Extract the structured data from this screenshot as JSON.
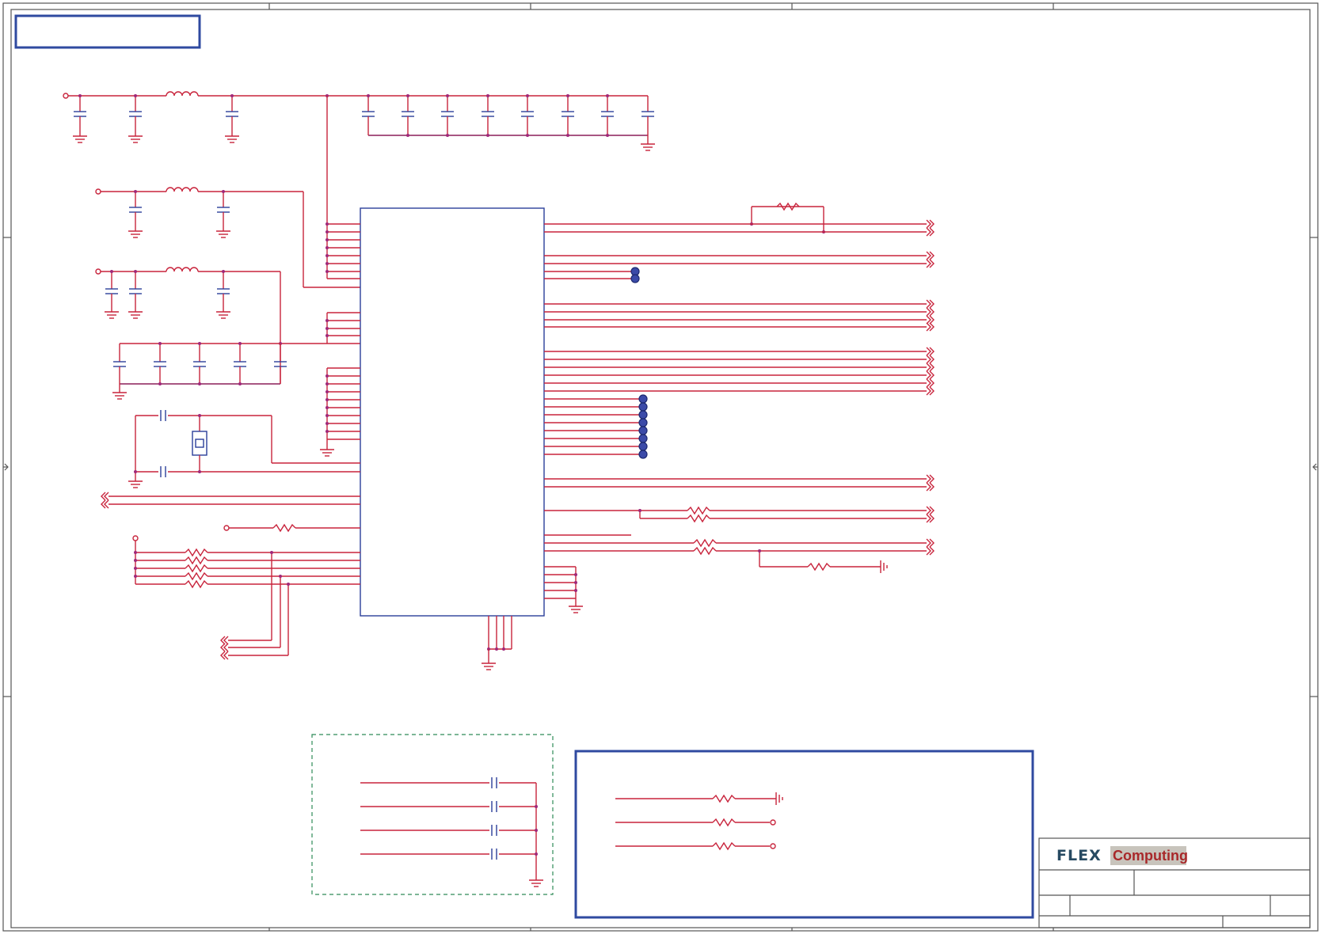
{
  "sheet": {
    "background": "#ffffff",
    "wire_color": "#c8243c",
    "junction_color": "#a0287a",
    "symbol_color": "#2b3f9a",
    "note_box_color": "#2f4aa0",
    "dashed_box_color": "#2e8b57"
  },
  "title_block": {
    "logo": {
      "word1": "FLEX",
      "word2": "Computing",
      "word1_color": "#274a62",
      "word2_bg_color": "#c8c4bc"
    }
  }
}
